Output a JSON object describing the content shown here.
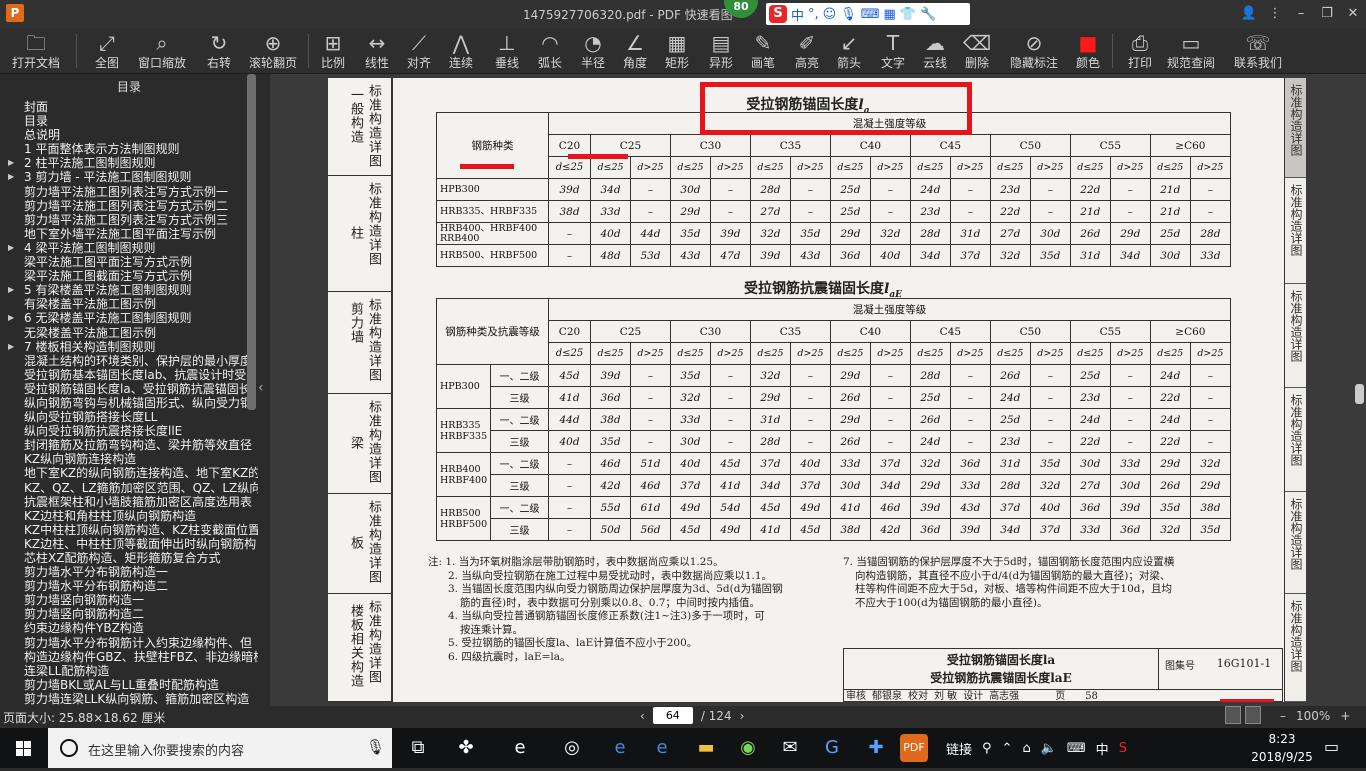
{
  "app": {
    "title": "1475927706320.pdf - PDF 快速看图",
    "badge": "80"
  },
  "ime": {
    "label": "中"
  },
  "toolbar": [
    {
      "label": "打开文档",
      "icon": "folder-icon",
      "g": "🗀"
    },
    {
      "label": "全图",
      "icon": "fit-page-icon",
      "g": "⤢"
    },
    {
      "label": "窗口缩放",
      "icon": "zoom-window-icon",
      "g": "⌕"
    },
    {
      "label": "右转",
      "icon": "rotate-right-icon",
      "g": "↻"
    },
    {
      "label": "滚轮翻页",
      "icon": "mouse-wheel-icon",
      "g": "⊕"
    },
    {
      "label": "比例",
      "icon": "scale-icon",
      "g": "⊞"
    },
    {
      "label": "线性",
      "icon": "linear-dim-icon",
      "g": "↔"
    },
    {
      "label": "对齐",
      "icon": "aligned-dim-icon",
      "g": "⟋"
    },
    {
      "label": "连续",
      "icon": "continuous-dim-icon",
      "g": "⋀"
    },
    {
      "label": "垂线",
      "icon": "perpendicular-icon",
      "g": "⊥"
    },
    {
      "label": "弧长",
      "icon": "arc-length-icon",
      "g": "◠"
    },
    {
      "label": "半径",
      "icon": "radius-icon",
      "g": "◔"
    },
    {
      "label": "角度",
      "icon": "angle-icon",
      "g": "∠"
    },
    {
      "label": "矩形",
      "icon": "rectangle-area-icon",
      "g": "▦"
    },
    {
      "label": "异形",
      "icon": "polygon-area-icon",
      "g": "▤"
    },
    {
      "label": "画笔",
      "icon": "pen-icon",
      "g": "✎"
    },
    {
      "label": "高亮",
      "icon": "highlight-icon",
      "g": "✐"
    },
    {
      "label": "箭头",
      "icon": "arrow-icon",
      "g": "↙"
    },
    {
      "label": "文字",
      "icon": "text-icon",
      "g": "T"
    },
    {
      "label": "云线",
      "icon": "cloud-line-icon",
      "g": "☁"
    },
    {
      "label": "删除",
      "icon": "eraser-icon",
      "g": "⌫"
    },
    {
      "label": "隐藏标注",
      "icon": "hide-markup-icon",
      "g": "⊘"
    },
    {
      "label": "颜色",
      "icon": "color-swatch-icon",
      "g": "■"
    },
    {
      "label": "打印",
      "icon": "print-icon",
      "g": "⎙"
    },
    {
      "label": "规范查阅",
      "icon": "book-icon",
      "g": "▭"
    },
    {
      "label": "联系我们",
      "icon": "contact-icon",
      "g": "☏"
    }
  ],
  "sidebar": {
    "title": "目录",
    "items": [
      {
        "t": "封面",
        "a": false
      },
      {
        "t": "目录",
        "a": false
      },
      {
        "t": "总说明",
        "a": false
      },
      {
        "t": "1 平面整体表示方法制图规则",
        "a": false
      },
      {
        "t": "2 柱平法施工图制图规则",
        "a": true
      },
      {
        "t": "3 剪力墙 - 平法施工图制图规则",
        "a": true
      },
      {
        "t": "剪力墙平法施工图列表注写方式示例一",
        "a": false
      },
      {
        "t": "剪力墙平法施工图列表注写方式示例二",
        "a": false
      },
      {
        "t": "剪力墙平法施工图列表注写方式示例三",
        "a": false
      },
      {
        "t": "地下室外墙平法施工图平面注写示例",
        "a": false
      },
      {
        "t": "4 梁平法施工图制图规则",
        "a": true
      },
      {
        "t": "梁平法施工图平面注写方式示例",
        "a": false
      },
      {
        "t": "梁平法施工图截面注写方式示例",
        "a": false
      },
      {
        "t": "5 有梁楼盖平法施工图制图规则",
        "a": true
      },
      {
        "t": "有梁楼盖平法施工图示例",
        "a": false
      },
      {
        "t": "6 无梁楼盖平法施工图制图规则",
        "a": true
      },
      {
        "t": "无梁楼盖平法施工图示例",
        "a": false
      },
      {
        "t": "7 楼板相关构造制图规则",
        "a": true
      },
      {
        "t": "混凝土结构的环境类别、保护层的最小厚度",
        "a": false
      },
      {
        "t": "受拉钢筋基本锚固长度lab、抗震设计时受",
        "a": false
      },
      {
        "t": "受拉钢筋锚固长度la、受拉钢筋抗震锚固长",
        "a": false
      },
      {
        "t": "纵向钢筋弯钩与机械锚固形式、纵向受力钢",
        "a": false
      },
      {
        "t": "纵向受拉钢筋搭接长度LL",
        "a": false
      },
      {
        "t": "纵向受拉钢筋抗震搭接长度llE",
        "a": false
      },
      {
        "t": "封闭箍筋及拉筋弯钩构造、梁并筋等效直径",
        "a": false
      },
      {
        "t": "KZ纵向钢筋连接构造",
        "a": false
      },
      {
        "t": "地下室KZ的纵向钢筋连接构造、地下室KZ的",
        "a": false
      },
      {
        "t": "KZ、QZ、LZ箍筋加密区范围、QZ、LZ纵向钢",
        "a": false
      },
      {
        "t": "抗震框架柱和小墙肢箍筋加密区高度选用表",
        "a": false
      },
      {
        "t": "KZ边柱和角柱柱顶纵向钢筋构造",
        "a": false
      },
      {
        "t": "KZ中柱柱顶纵向钢筋构造、KZ柱变截面位置",
        "a": false
      },
      {
        "t": "KZ边柱、中柱柱顶等截面伸出时纵向钢筋构",
        "a": false
      },
      {
        "t": "芯柱XZ配筋构造、矩形箍筋复合方式",
        "a": false
      },
      {
        "t": "剪力墙水平分布钢筋构造一",
        "a": false
      },
      {
        "t": "剪力墙水平分布钢筋构造二",
        "a": false
      },
      {
        "t": "剪力墙竖向钢筋构造一",
        "a": false
      },
      {
        "t": "剪力墙竖向钢筋构造二",
        "a": false
      },
      {
        "t": "约束边缘构件YBZ构造",
        "a": false
      },
      {
        "t": "剪力墙水平分布钢筋计入约束边缘构件、但",
        "a": false
      },
      {
        "t": "构造边缘构件GBZ、扶壁柱FBZ、非边缘暗柱",
        "a": false
      },
      {
        "t": "连梁LL配筋构造",
        "a": false
      },
      {
        "t": "剪力墙BKL或AL与LL重叠时配筋构造",
        "a": false
      },
      {
        "t": "剪力墙连梁LLK纵向钢筋、箍筋加密区构造",
        "a": false
      }
    ]
  },
  "doc": {
    "left_tabs": [
      "一般构造详图",
      "柱",
      "标准构造详图",
      "剪力墙",
      "标准构造详图",
      "梁",
      "标准构造详图",
      "板",
      "标准构造详图",
      "楼板相关构造",
      "标准构造详图"
    ],
    "right_tabs": [
      "标准构造详图",
      "标准构造详图",
      "标准构造详图",
      "标准构造详图",
      "标准构造详图",
      "标准构造详图"
    ],
    "t1": {
      "title": "受拉钢筋锚固长度",
      "sub": "a",
      "head_grade": "混凝土强度等级",
      "head_type": "钢筋种类",
      "grades": [
        "C20",
        "C25",
        "C30",
        "C35",
        "C40",
        "C45",
        "C50",
        "C55",
        "≥C60"
      ],
      "dle": "d≤25",
      "dgt": "d>25",
      "rows": [
        {
          "n": "HPB300",
          "v": [
            "39d",
            "34d",
            "–",
            "30d",
            "–",
            "28d",
            "–",
            "25d",
            "–",
            "24d",
            "–",
            "23d",
            "–",
            "22d",
            "–",
            "21d",
            "–"
          ]
        },
        {
          "n": "HRB335、HRBF335",
          "v": [
            "38d",
            "33d",
            "–",
            "29d",
            "–",
            "27d",
            "–",
            "25d",
            "–",
            "23d",
            "–",
            "22d",
            "–",
            "21d",
            "–",
            "21d",
            "–"
          ]
        },
        {
          "n": "HRB400、HRBF400 RRB400",
          "v": [
            "–",
            "40d",
            "44d",
            "35d",
            "39d",
            "32d",
            "35d",
            "29d",
            "32d",
            "28d",
            "31d",
            "27d",
            "30d",
            "26d",
            "29d",
            "25d",
            "28d"
          ]
        },
        {
          "n": "HRB500、HRBF500",
          "v": [
            "–",
            "48d",
            "53d",
            "43d",
            "47d",
            "39d",
            "43d",
            "36d",
            "40d",
            "34d",
            "37d",
            "32d",
            "35d",
            "31d",
            "34d",
            "30d",
            "33d"
          ]
        }
      ]
    },
    "t2": {
      "title": "受拉钢筋抗震锚固长度",
      "sub": "aE",
      "head_type": "钢筋种类及抗震等级",
      "lv12": "一、二级",
      "lv3": "三级",
      "groups": [
        {
          "n": "HPB300",
          "r": [
            [
              "45d",
              "39d",
              "–",
              "35d",
              "–",
              "32d",
              "–",
              "29d",
              "–",
              "28d",
              "–",
              "26d",
              "–",
              "25d",
              "–",
              "24d",
              "–"
            ],
            [
              "41d",
              "36d",
              "–",
              "32d",
              "–",
              "29d",
              "–",
              "26d",
              "–",
              "25d",
              "–",
              "24d",
              "–",
              "23d",
              "–",
              "22d",
              "–"
            ]
          ]
        },
        {
          "n": "HRB335 HRBF335",
          "r": [
            [
              "44d",
              "38d",
              "–",
              "33d",
              "–",
              "31d",
              "–",
              "29d",
              "–",
              "26d",
              "–",
              "25d",
              "–",
              "24d",
              "–",
              "24d",
              "–"
            ],
            [
              "40d",
              "35d",
              "–",
              "30d",
              "–",
              "28d",
              "–",
              "26d",
              "–",
              "24d",
              "–",
              "23d",
              "–",
              "22d",
              "–",
              "22d",
              "–"
            ]
          ]
        },
        {
          "n": "HRB400 HRBF400",
          "r": [
            [
              "–",
              "46d",
              "51d",
              "40d",
              "45d",
              "37d",
              "40d",
              "33d",
              "37d",
              "32d",
              "36d",
              "31d",
              "35d",
              "30d",
              "33d",
              "29d",
              "32d"
            ],
            [
              "–",
              "42d",
              "46d",
              "37d",
              "41d",
              "34d",
              "37d",
              "30d",
              "34d",
              "29d",
              "33d",
              "28d",
              "32d",
              "27d",
              "30d",
              "26d",
              "29d"
            ]
          ]
        },
        {
          "n": "HRB500 HRBF500",
          "r": [
            [
              "–",
              "55d",
              "61d",
              "49d",
              "54d",
              "45d",
              "49d",
              "41d",
              "46d",
              "39d",
              "43d",
              "37d",
              "40d",
              "36d",
              "39d",
              "35d",
              "38d"
            ],
            [
              "–",
              "50d",
              "56d",
              "45d",
              "49d",
              "41d",
              "45d",
              "38d",
              "42d",
              "36d",
              "39d",
              "34d",
              "37d",
              "33d",
              "36d",
              "32d",
              "35d"
            ]
          ]
        }
      ]
    },
    "notes_left": [
      "注: 1. 当为环氧树脂涂层带肋钢筋时，表中数据尚应乘以1.25。",
      "2. 当纵向受拉钢筋在施工过程中易受扰动时，表中数据尚应乘以1.1。",
      "3. 当锚固长度范围内纵向受力钢筋周边保护层厚度为3d、5d(d为锚固钢",
      "筋的直径)时，表中数据可分别乘以0.8、0.7；中间时按内插值。",
      "4. 当纵向受拉普通钢筋锚固长度修正系数(注1~注3)多于一项时，可",
      "按连乘计算。",
      "5. 受拉钢筋的锚固长度la、laE计算值不应小于200。",
      "6. 四级抗震时，laE=la。"
    ],
    "notes_right": [
      "7. 当锚固钢筋的保护层厚度不大于5d时，锚固钢筋长度范围内应设置横",
      "向构造钢筋，其直径不应小于d/4(d为锚固钢筋的最大直径)；对梁、",
      "柱等构件间距不应大于5d，对板、墙等构件间距不应大于10d，且均",
      "不应大于100(d为锚固钢筋的最小直径)。"
    ],
    "titleblock": {
      "line1": "受拉钢筋锚固长度la",
      "line2": "受拉钢筋抗震锚固长度laE",
      "atlas_label": "图集号",
      "atlas": "16G101-1",
      "check": "审核",
      "checker": "郁银泉",
      "proof": "校对",
      "proofer": "刘 敏",
      "design": "设计",
      "designer": "高志强",
      "page_label": "页",
      "page": "58"
    }
  },
  "status": {
    "pagesize": "页面大小: 25.88×18.62 厘米",
    "page": "64",
    "total": "/ 124",
    "zoom": "100%"
  },
  "taskbar": {
    "search_placeholder": "在这里输入你要搜索的内容",
    "link": "链接",
    "lang": "中",
    "time": "8:23",
    "date": "2018/9/25"
  }
}
